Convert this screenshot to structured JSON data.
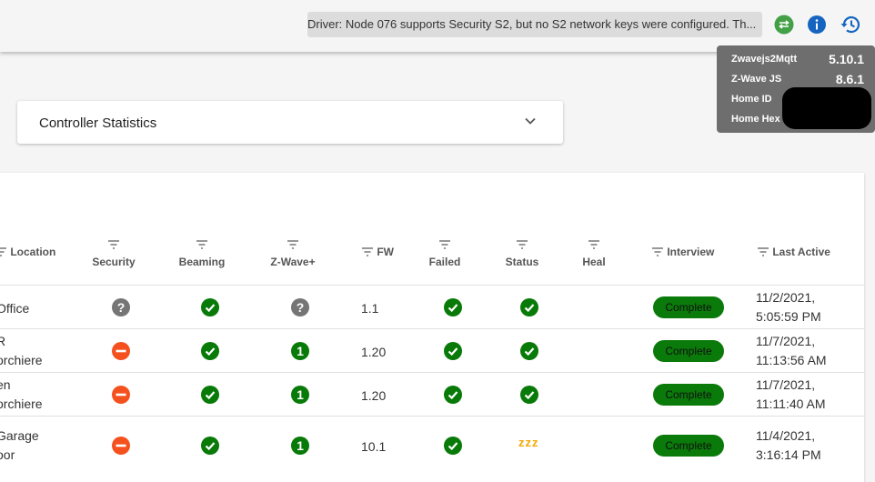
{
  "topbar": {
    "driver_message": "Driver: Node 076 supports Security S2, but no S2 network keys were configured. Th...",
    "colors": {
      "sync": "#43a047",
      "info": "#1565c0",
      "history": "#1565c0"
    }
  },
  "info_panel": {
    "rows": [
      {
        "label": "Zwavejs2Mqtt",
        "value": "5.10.1"
      },
      {
        "label": "Z-Wave JS",
        "value": "8.6.1"
      },
      {
        "label": "Home ID",
        "value": ""
      },
      {
        "label": "Home Hex",
        "value": ""
      }
    ]
  },
  "controller_statistics": {
    "title": "Controller Statistics"
  },
  "table": {
    "headers": {
      "location": "Location",
      "security": "Security",
      "beaming": "Beaming",
      "zwave_plus": "Z-Wave+",
      "fw": "FW",
      "failed": "Failed",
      "status": "Status",
      "heal": "Heal",
      "interview": "Interview",
      "last_active": "Last Active"
    },
    "rows": [
      {
        "loc1": "Office",
        "loc2": "",
        "security": "unknown",
        "beaming": "yes",
        "zwave_plus": "unknown",
        "fw": "1.1",
        "failed": "yes",
        "status": "alive",
        "interview": "Complete",
        "active1": "11/2/2021,",
        "active2": "5:05:59 PM"
      },
      {
        "loc1": "R",
        "loc2": "orchiere",
        "security": "none",
        "beaming": "yes",
        "zwave_plus": "1",
        "fw": "1.20",
        "failed": "yes",
        "status": "alive",
        "interview": "Complete",
        "active1": "11/7/2021,",
        "active2": "11:13:56 AM"
      },
      {
        "loc1": "en",
        "loc2": "orchiere",
        "security": "none",
        "beaming": "yes",
        "zwave_plus": "1",
        "fw": "1.20",
        "failed": "yes",
        "status": "alive",
        "interview": "Complete",
        "active1": "11/7/2021,",
        "active2": "11:11:40 AM"
      },
      {
        "loc1": "Garage",
        "loc2": "oor",
        "security": "none",
        "beaming": "yes",
        "zwave_plus": "1",
        "fw": "10.1",
        "failed": "yes",
        "status": "asleep",
        "interview": "Complete",
        "active1": "11/4/2021,",
        "active2": "3:16:14 PM"
      }
    ],
    "zzz": "zzz"
  }
}
